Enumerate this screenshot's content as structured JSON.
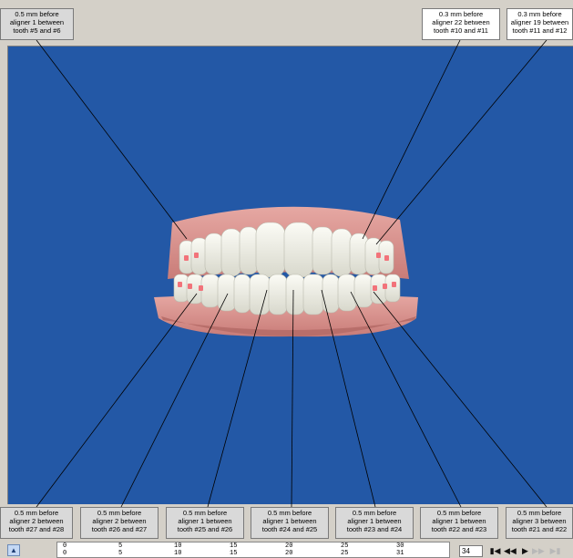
{
  "top_callouts": [
    {
      "lines": [
        "0.5 mm before",
        "aligner 1 between",
        "tooth #5 and #6"
      ]
    },
    {
      "lines": [
        "0.3 mm before",
        "aligner 22 between",
        "tooth #10 and #11"
      ]
    },
    {
      "lines": [
        "0.3 mm before",
        "aligner 19 between",
        "tooth #11 and #12"
      ]
    }
  ],
  "bottom_callouts": [
    {
      "lines": [
        "0.5 mm before",
        "aligner 2 between",
        "tooth #27 and #28"
      ]
    },
    {
      "lines": [
        "0.5 mm before",
        "aligner 2 between",
        "tooth #26 and #27"
      ]
    },
    {
      "lines": [
        "0.5 mm before",
        "aligner 1 between",
        "tooth #25 and #26"
      ]
    },
    {
      "lines": [
        "0.5 mm before",
        "aligner 1 between",
        "tooth #24 and #25"
      ]
    },
    {
      "lines": [
        "0.5 mm before",
        "aligner 1 between",
        "tooth #23 and #24"
      ]
    },
    {
      "lines": [
        "0.5 mm before",
        "aligner 1 between",
        "tooth #22 and #23"
      ]
    },
    {
      "lines": [
        "0.5 mm before",
        "aligner 3 between",
        "tooth #21 and #22"
      ]
    }
  ],
  "timeline": {
    "upper_ticks": [
      "0",
      "5",
      "10",
      "15",
      "20",
      "25",
      "30"
    ],
    "lower_ticks": [
      "0",
      "5",
      "10",
      "15",
      "20",
      "25",
      "31"
    ],
    "current_stage": "34"
  },
  "nav_buttons": [
    "first-stage",
    "previous-stage",
    "play",
    "next-stage",
    "last-stage"
  ],
  "colors": {
    "viewport_bg": "#2358a6",
    "gum": "#dc9490",
    "tooth": "#f2f2ea",
    "attachment": "#f2737a",
    "chrome": "#d4d0c8"
  }
}
